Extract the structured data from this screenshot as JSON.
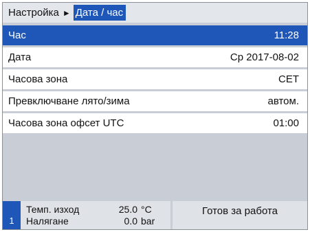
{
  "header": {
    "root": "Настройка",
    "separator": "►",
    "current": "Дата / час"
  },
  "menu": [
    {
      "label": "Час",
      "value": "11:28",
      "selected": true
    },
    {
      "label": "Дата",
      "value": "Ср 2017-08-02",
      "selected": false
    },
    {
      "label": "Часова зона",
      "value": "CET",
      "selected": false
    },
    {
      "label": "Превключване лято/зима",
      "value": "автом.",
      "selected": false
    },
    {
      "label": "Часова зона офсет UTC",
      "value": "01:00",
      "selected": false
    }
  ],
  "footer": {
    "slot": "1",
    "readings": [
      {
        "label": "Темп. изход",
        "value": "25.0",
        "unit": "°C"
      },
      {
        "label": "Налягане",
        "value": "0.0",
        "unit": "bar"
      }
    ],
    "status": "Готов за работа"
  },
  "colors": {
    "accent": "#1f57b8",
    "background": "#c9ced6",
    "panel": "#dfe2e6"
  }
}
